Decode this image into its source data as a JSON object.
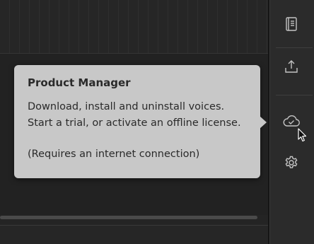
{
  "tooltip": {
    "title": "Product Manager",
    "description": "Download, install and uninstall voices. Start a trial, or activate an offline license.",
    "note": "(Requires an internet connection)"
  },
  "sidebar": {
    "items": [
      {
        "icon": "book-icon"
      },
      {
        "icon": "upload-icon"
      },
      {
        "icon": "cloud-check-icon"
      },
      {
        "icon": "gear-icon"
      }
    ]
  },
  "colors": {
    "background": "#1c1c1c",
    "sidebar": "#2b2b2b",
    "tooltip": "#c8c8c8",
    "icon": "#c4c4c4"
  }
}
